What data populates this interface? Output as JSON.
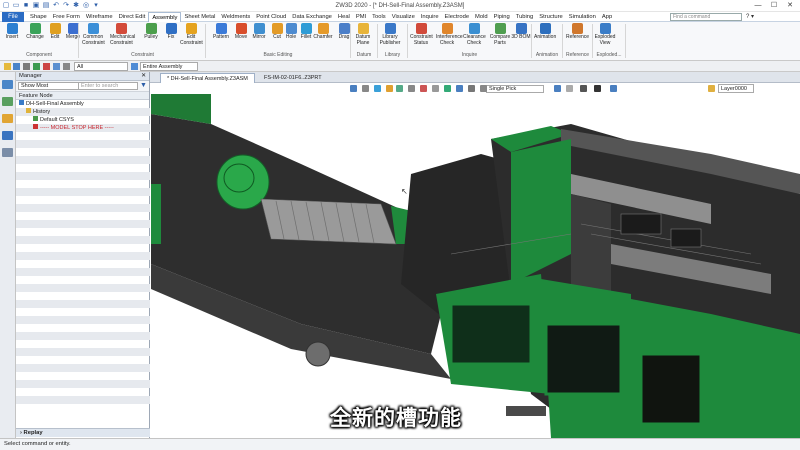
{
  "app": {
    "title": "ZW3D 2020 - [* DH-Sell-Final Assembly.Z3ASM]",
    "quick_access_icons": [
      "new-icon",
      "open-icon",
      "save-icon",
      "save-as-icon",
      "print-icon",
      "undo-icon",
      "redo-icon",
      "settings-icon",
      "target-icon",
      "dropdown-icon"
    ]
  },
  "menu": {
    "file_label": "File",
    "tabs": [
      "Shape",
      "Free Form",
      "Wireframe",
      "Direct Edit",
      "Assembly",
      "Sheet Metal",
      "Weldments",
      "Point Cloud",
      "Data Exchange",
      "Heal",
      "PMI",
      "Tools",
      "Visualize",
      "Inquire",
      "Electrode",
      "Mold",
      "Piping",
      "Tubing",
      "Structure",
      "Simulation",
      "App"
    ],
    "active_tab": "Assembly",
    "command_search_placeholder": "Find a command"
  },
  "ribbon": {
    "buttons": [
      {
        "label": "Insert",
        "icon": "insert-icon",
        "color": "#2d7fd1"
      },
      {
        "label": "Change",
        "icon": "change-icon",
        "color": "#3aa35a"
      },
      {
        "label": "Edit",
        "icon": "edit-icon",
        "color": "#e0a020"
      },
      {
        "label": "Merge",
        "icon": "merge-icon",
        "color": "#3c6fd0"
      },
      {
        "label": "Common Constraint",
        "icon": "common-constraint-icon",
        "color": "#3b8fd8"
      },
      {
        "label": "Mechanical Constraint",
        "icon": "mechanical-constraint-icon",
        "color": "#d34b3a"
      },
      {
        "label": "Pulley",
        "icon": "pulley-icon",
        "color": "#4c9f4c"
      },
      {
        "label": "Fix",
        "icon": "fix-icon",
        "color": "#2f6fc4"
      },
      {
        "label": "Edit Constraint",
        "icon": "edit-constraint-icon",
        "color": "#e5a31f"
      },
      {
        "label": "Pattern",
        "icon": "pattern-icon",
        "color": "#3b7ad8"
      },
      {
        "label": "Move",
        "icon": "move-icon",
        "color": "#d94e2c"
      },
      {
        "label": "Mirror",
        "icon": "mirror-icon",
        "color": "#3f8fd0"
      },
      {
        "label": "Cut",
        "icon": "cut-icon",
        "color": "#e39b27"
      },
      {
        "label": "Hole",
        "icon": "hole-icon",
        "color": "#4d8bd0"
      },
      {
        "label": "Fillet",
        "icon": "fillet-icon",
        "color": "#2f9cd6"
      },
      {
        "label": "Chamfer",
        "icon": "chamfer-icon",
        "color": "#e59a2a"
      },
      {
        "label": "Drag",
        "icon": "drag-icon",
        "color": "#4b7fc9"
      },
      {
        "label": "Datum Plane",
        "icon": "datum-plane-icon",
        "color": "#e8b43a"
      },
      {
        "label": "Library Publisher",
        "icon": "library-publisher-icon",
        "color": "#3a78c8"
      },
      {
        "label": "Constraint Status",
        "icon": "constraint-status-icon",
        "color": "#d14a3b"
      },
      {
        "label": "Interference Check",
        "icon": "interference-check-icon",
        "color": "#e0862c"
      },
      {
        "label": "Clearance Check",
        "icon": "clearance-check-icon",
        "color": "#3a8fd2"
      },
      {
        "label": "Compare Parts",
        "icon": "compare-parts-icon",
        "color": "#4f9e50"
      },
      {
        "label": "3D BOM",
        "icon": "3d-bom-icon",
        "color": "#3673c4"
      },
      {
        "label": "Animation",
        "icon": "animation-icon",
        "color": "#2d6fbe"
      },
      {
        "label": "Reference",
        "icon": "reference-icon",
        "color": "#d0772c"
      },
      {
        "label": "Exploded View",
        "icon": "exploded-view-icon",
        "color": "#3a7dc8"
      }
    ],
    "groups": [
      "Component",
      "Constraint",
      "Basic Editing",
      "Datum",
      "Library",
      "Inquire",
      "Animation",
      "Reference",
      "Exploded..."
    ]
  },
  "filterbar": {
    "filter_value": "All",
    "scope_value": "Entire Assembly"
  },
  "manager": {
    "title": "Manager",
    "show_value": "Show Most",
    "search_placeholder": "Enter to search",
    "column_header": "Feature Node",
    "tree": [
      {
        "label": "DH-Sell-Final Assembly",
        "level": 0
      },
      {
        "label": "History",
        "level": 1
      },
      {
        "label": "Default CSYS",
        "level": 2
      },
      {
        "label": "----- MODEL STOP HERE -----",
        "level": 2
      }
    ],
    "replay_label": "Replay"
  },
  "documents": {
    "tabs": [
      "* DH-Sell-Final Assembly.Z3ASM",
      "FS-IM-02-01F6..Z3PRT"
    ],
    "active": 0
  },
  "viewport_toolbar": {
    "pick_value": "Single Pick",
    "layer_value": "Layer0000"
  },
  "caption": "全新的槽功能",
  "status": "Select command or entity.",
  "colors": {
    "accent": "#2b6cc4",
    "machine_green": "#1e8a3c",
    "machine_dark": "#2b2b2b",
    "machine_gray": "#8a8a8a"
  }
}
